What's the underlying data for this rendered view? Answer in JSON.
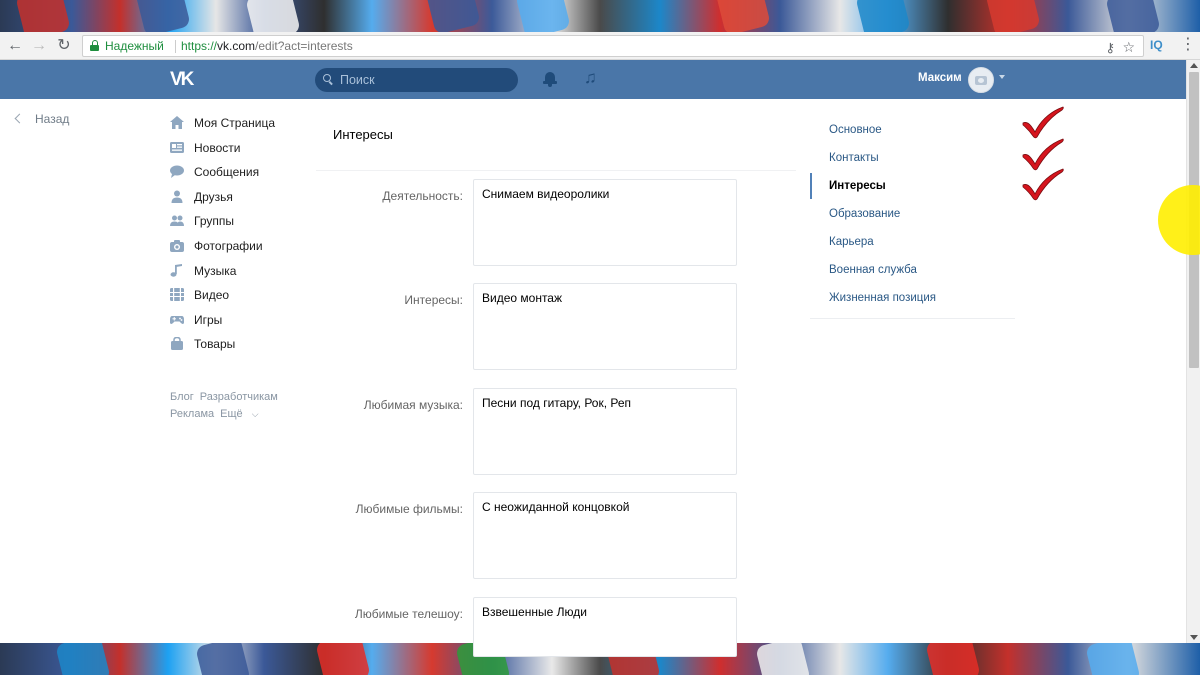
{
  "browser": {
    "secure_label": "Надежный",
    "url_scheme": "https://",
    "url_host": "vk.com",
    "url_path": "/edit?act=interests",
    "extension_label": "IQ"
  },
  "header": {
    "logo": "VK",
    "search_placeholder": "Поиск",
    "user_name": "Максим"
  },
  "back_label": "Назад",
  "left_nav": [
    {
      "label": "Моя Страница",
      "icon": "home-icon"
    },
    {
      "label": "Новости",
      "icon": "news-icon"
    },
    {
      "label": "Сообщения",
      "icon": "messages-icon"
    },
    {
      "label": "Друзья",
      "icon": "friends-icon"
    },
    {
      "label": "Группы",
      "icon": "groups-icon"
    },
    {
      "label": "Фотографии",
      "icon": "camera-icon"
    },
    {
      "label": "Музыка",
      "icon": "music-note-icon"
    },
    {
      "label": "Видео",
      "icon": "video-icon"
    },
    {
      "label": "Игры",
      "icon": "gamepad-icon"
    },
    {
      "label": "Товары",
      "icon": "bag-icon"
    }
  ],
  "footer_links": {
    "blog": "Блог",
    "developers": "Разработчикам",
    "ads": "Реклама",
    "more": "Ещё"
  },
  "content": {
    "title": "Интересы",
    "fields": [
      {
        "label": "Деятельность:",
        "value": "Снимаем видеоролики"
      },
      {
        "label": "Интересы:",
        "value": "Видео монтаж"
      },
      {
        "label": "Любимая музыка:",
        "value": "Песни под гитару, Рок, Реп"
      },
      {
        "label": "Любимые фильмы:",
        "value": "С неожиданной концовкой"
      },
      {
        "label": "Любимые телешоу:",
        "value": "Взвешенные Люди"
      }
    ]
  },
  "right_menu": {
    "items": [
      {
        "label": "Основное",
        "active": false
      },
      {
        "label": "Контакты",
        "active": false
      },
      {
        "label": "Интересы",
        "active": true
      },
      {
        "label": "Образование",
        "active": false
      },
      {
        "label": "Карьера",
        "active": false
      },
      {
        "label": "Военная служба",
        "active": false
      },
      {
        "label": "Жизненная позиция",
        "active": false
      }
    ]
  },
  "colors": {
    "vk_blue": "#4a76a8",
    "link": "#2a5885",
    "check_red": "#d6141d"
  }
}
